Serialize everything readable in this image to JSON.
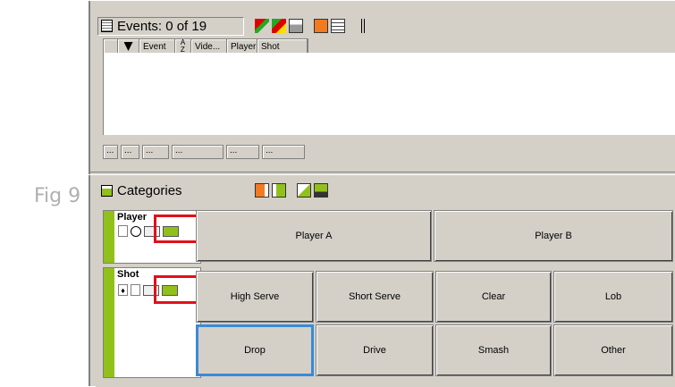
{
  "caption": "Fig 9",
  "events_panel": {
    "title": "Events: 0 of 19",
    "toolbar_icons": [
      "flag-icon",
      "flags-icon",
      "properties-icon",
      "orange-panel-icon",
      "list-view-icon",
      "split-icon"
    ],
    "columns": [
      {
        "icon": "pin-icon",
        "label": ""
      },
      {
        "icon": "",
        "label": "Event"
      },
      {
        "icon": "sort-az-icon",
        "label": ""
      },
      {
        "icon": "",
        "label": "Vide..."
      },
      {
        "icon": "",
        "label": "Player"
      },
      {
        "icon": "",
        "label": "Shot"
      }
    ],
    "footer_cells": [
      "...",
      "...",
      "...",
      "...",
      "...",
      "..."
    ]
  },
  "categories_panel": {
    "title": "Categories",
    "toolbar_icons": [
      "orange-panel-icon",
      "green-panel-icon",
      "edit-icon",
      "save-icon"
    ],
    "rows": [
      {
        "label": "Player",
        "buttons": [
          "Player A",
          "Player B"
        ]
      },
      {
        "label": "Shot",
        "buttons": [
          "High Serve",
          "Short Serve",
          "Clear",
          "Lob",
          "Drop",
          "Drive",
          "Smash",
          "Other"
        ]
      }
    ],
    "accent": "#92c01b",
    "highlight": "#e0101a",
    "focus": "#3b8ad6"
  }
}
